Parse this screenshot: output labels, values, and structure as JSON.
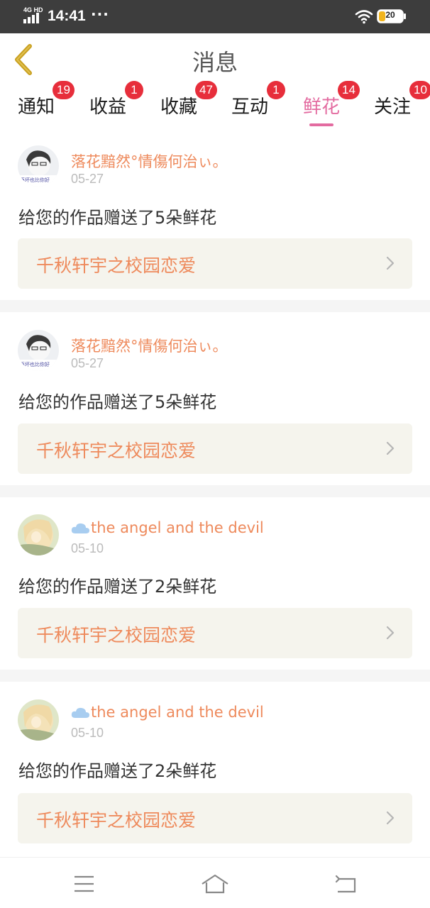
{
  "status_bar": {
    "network": "4G HD",
    "time": "14:41",
    "dots": "···",
    "battery": "20"
  },
  "header": {
    "title": "消息",
    "back_icon": "chevron-left-icon"
  },
  "tabs": [
    {
      "label": "通知",
      "badge": "19",
      "active": false
    },
    {
      "label": "收益",
      "badge": "1",
      "active": false
    },
    {
      "label": "收藏",
      "badge": "47",
      "active": false
    },
    {
      "label": "互动",
      "badge": "1",
      "active": false
    },
    {
      "label": "鲜花",
      "badge": "14",
      "active": true
    },
    {
      "label": "关注",
      "badge": "10",
      "active": false
    }
  ],
  "notifications": [
    {
      "user": "落花黯然°情傷何治ぃ。",
      "date": "05-27",
      "message": "给您的作品赠送了5朵鲜花",
      "work": "千秋轩宇之校园恋爱",
      "avatar_caption": "再坏也比你好"
    },
    {
      "user": "落花黯然°情傷何治ぃ。",
      "date": "05-27",
      "message": "给您的作品赠送了5朵鲜花",
      "work": "千秋轩宇之校园恋爱",
      "avatar_caption": "再坏也比你好"
    },
    {
      "user": "the angel and the devil",
      "date": "05-10",
      "message": "给您的作品赠送了2朵鲜花",
      "work": "千秋轩宇之校园恋爱"
    },
    {
      "user": "the angel and the devil",
      "date": "05-10",
      "message": "给您的作品赠送了2朵鲜花",
      "work": "千秋轩宇之校园恋爱"
    }
  ],
  "bottom_nav": {
    "menu_icon": "menu-icon",
    "home_icon": "home-icon",
    "back_icon": "return-icon"
  },
  "colors": {
    "accent": "#e36ba0",
    "username": "#ee8a5c",
    "badge": "#e72e3b",
    "back_arrow": "#c9a020"
  }
}
